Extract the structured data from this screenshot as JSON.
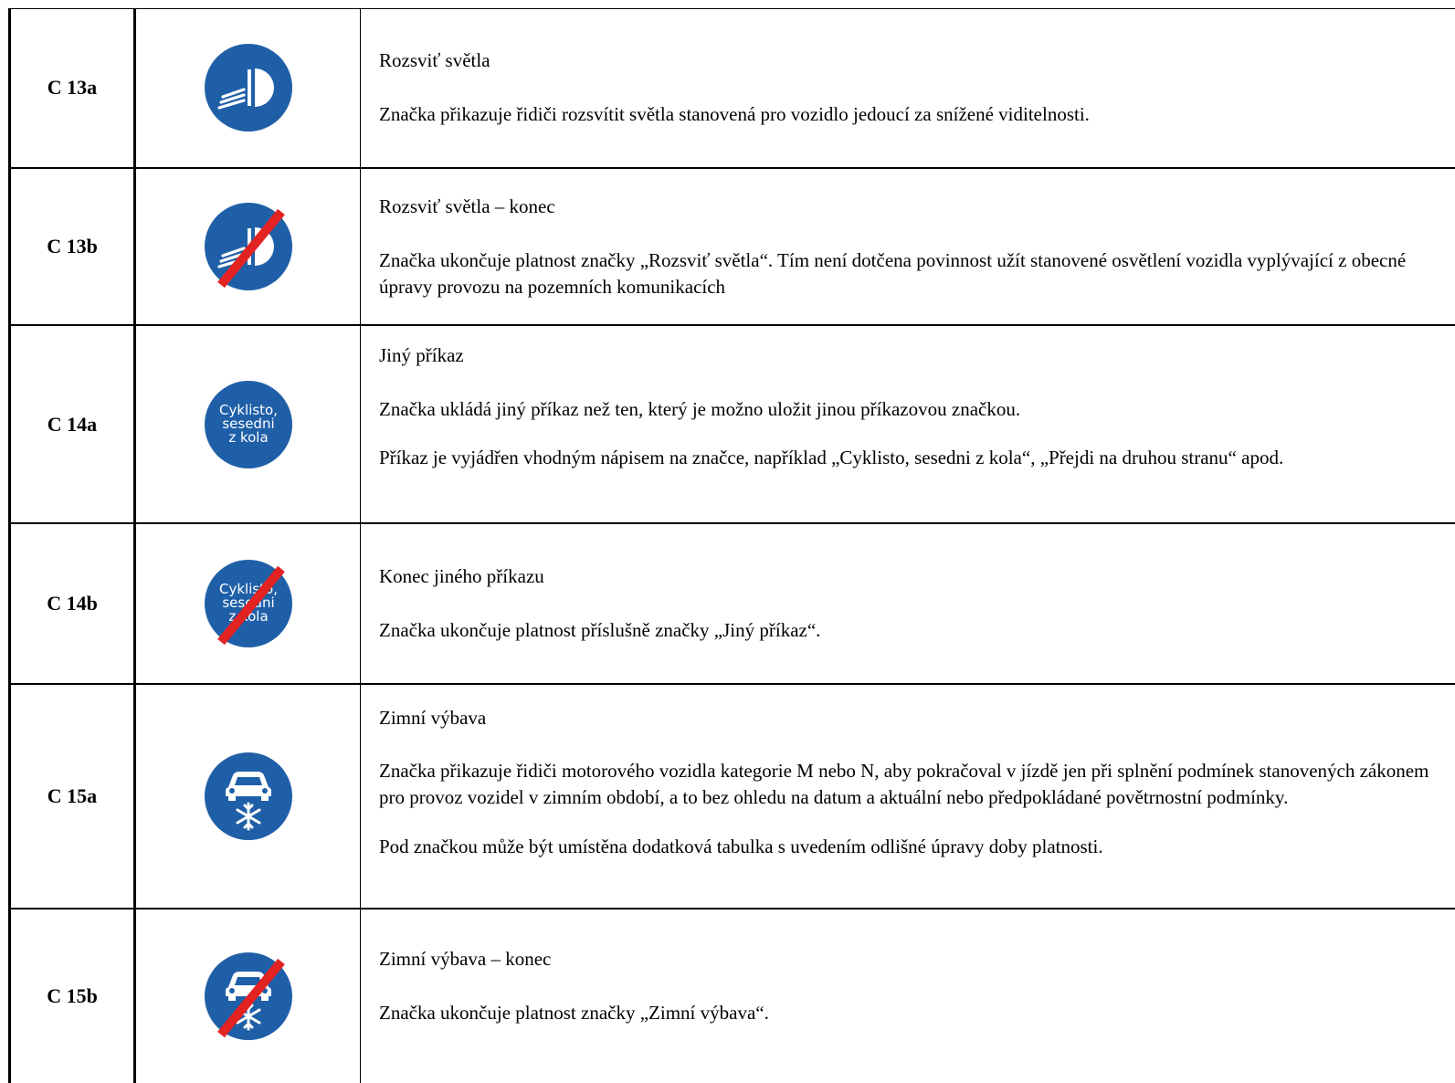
{
  "rows": [
    {
      "code": "C 13a",
      "sign_icon": "headlight-on-sign-icon",
      "title": "Rozsviť světla",
      "paragraphs": [
        "Značka přikazuje řidiči rozsvítit světla stanovená pro vozidlo jedoucí za snížené viditelnosti."
      ]
    },
    {
      "code": "C 13b",
      "sign_icon": "headlight-on-end-sign-icon",
      "title": "Rozsviť světla – konec",
      "paragraphs": [
        "Značka ukončuje platnost značky „Rozsviť světla“. Tím není dotčena povinnost užít stanovené osvětlení vozidla vyplývající z obecné úpravy provozu na pozemních komunikacích"
      ]
    },
    {
      "code": "C 14a",
      "sign_icon": "other-order-sign-icon",
      "sign_text": [
        "Cyklisto,",
        "sesedni",
        "z kola"
      ],
      "title": "Jiný příkaz",
      "paragraphs": [
        "Značka ukládá jiný příkaz než ten, který je možno uložit jinou příkazovou značkou.",
        "Příkaz je vyjádřen vhodným nápisem na značce, například „Cyklisto, sesedni z kola“, „Přejdi na druhou stranu“ apod."
      ]
    },
    {
      "code": "C 14b",
      "sign_icon": "other-order-end-sign-icon",
      "sign_text": [
        "Cyklisto,",
        "sesedni",
        "z kola"
      ],
      "title": "Konec jiného příkazu",
      "paragraphs": [
        "Značka ukončuje platnost příslušně značky „Jiný příkaz“."
      ]
    },
    {
      "code": "C 15a",
      "sign_icon": "winter-equipment-sign-icon",
      "title": "Zimní výbava",
      "paragraphs": [
        "Značka přikazuje řidiči motorového vozidla kategorie M nebo N, aby pokračoval v jízdě jen při splnění podmínek stanovených zákonem pro provoz vozidel v zimním období, a to bez ohledu na datum a aktuální nebo předpokládané povětrnostní podmínky.",
        "Pod značkou může být umístěna dodatková tabulka s uvedením odlišné úpravy doby platnosti."
      ]
    },
    {
      "code": "C 15b",
      "sign_icon": "winter-equipment-end-sign-icon",
      "title": "Zimní výbava – konec",
      "paragraphs": [
        "Značka ukončuje platnost značky „Zimní výbava“."
      ]
    }
  ],
  "colors": {
    "sign_blue": "#1f5fa8",
    "sign_red": "#e32222",
    "border": "#000000"
  }
}
